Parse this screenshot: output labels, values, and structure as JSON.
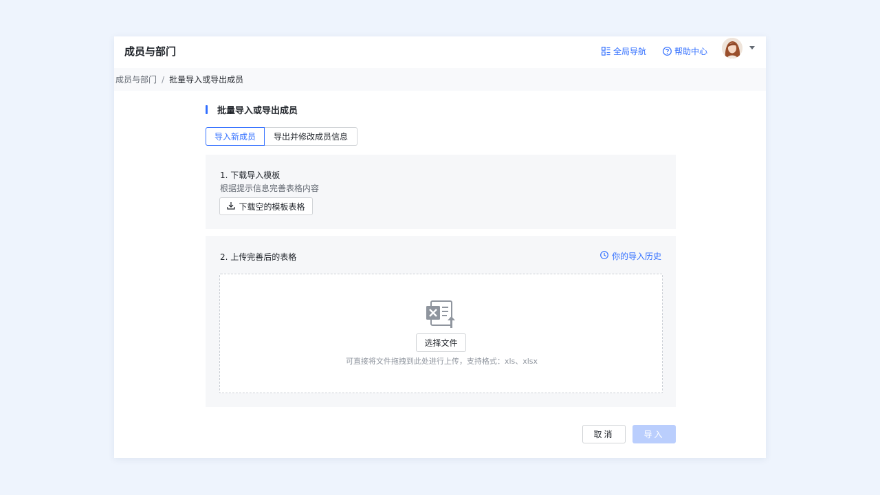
{
  "header": {
    "title": "成员与部门",
    "nav_label": "全局导航",
    "help_label": "帮助中心"
  },
  "breadcrumb": {
    "root": "成员与部门",
    "separator": "/",
    "current": "批量导入或导出成员"
  },
  "section": {
    "title": "批量导入或导出成员"
  },
  "tabs": [
    {
      "label": "导入新成员",
      "active": true
    },
    {
      "label": "导出并修改成员信息",
      "active": false
    }
  ],
  "step1": {
    "title": "1. 下载导入模板",
    "desc": "根据提示信息完善表格内容",
    "button_label": "下载空的模板表格"
  },
  "step2": {
    "title": "2. 上传完善后的表格",
    "history_label": "你的导入历史",
    "choose_label": "选择文件",
    "hint": "可直接将文件拖拽到此处进行上传，支持格式：xls、xlsx"
  },
  "footer": {
    "cancel_label": "取消",
    "import_label": "导入"
  },
  "colors": {
    "accent": "#3370ff",
    "import_disabled": "#bacefd",
    "page_bg": "#eef4fd"
  }
}
